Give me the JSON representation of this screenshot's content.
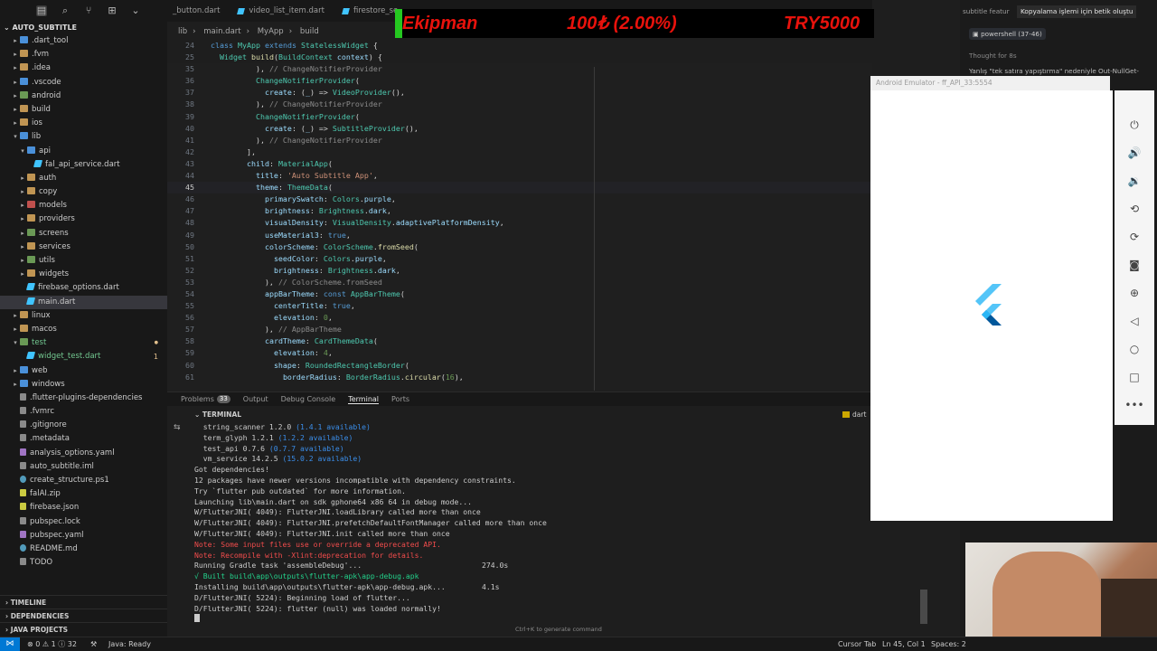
{
  "explorer": {
    "title": "AUTO_SUBTITLE",
    "items": [
      {
        "label": ".dart_tool",
        "type": "folder",
        "color": "folder-b",
        "depth": 1,
        "arrow": "▸"
      },
      {
        "label": ".fvm",
        "type": "folder",
        "color": "folder",
        "depth": 1,
        "arrow": "▸"
      },
      {
        "label": ".idea",
        "type": "folder",
        "color": "folder",
        "depth": 1,
        "arrow": "▸"
      },
      {
        "label": ".vscode",
        "type": "folder",
        "color": "folder-b",
        "depth": 1,
        "arrow": "▸"
      },
      {
        "label": "android",
        "type": "folder",
        "color": "folder-g",
        "depth": 1,
        "arrow": "▸"
      },
      {
        "label": "build",
        "type": "folder",
        "color": "folder",
        "depth": 1,
        "arrow": "▸"
      },
      {
        "label": "ios",
        "type": "folder",
        "color": "folder",
        "depth": 1,
        "arrow": "▸"
      },
      {
        "label": "lib",
        "type": "folder",
        "color": "folder-b",
        "depth": 1,
        "arrow": "▾"
      },
      {
        "label": "api",
        "type": "folder",
        "color": "folder-b",
        "depth": 2,
        "arrow": "▾"
      },
      {
        "label": "fal_api_service.dart",
        "type": "dart",
        "color": "dart",
        "depth": 3,
        "arrow": ""
      },
      {
        "label": "auth",
        "type": "folder",
        "color": "folder",
        "depth": 2,
        "arrow": "▸"
      },
      {
        "label": "copy",
        "type": "folder",
        "color": "folder",
        "depth": 2,
        "arrow": "▸"
      },
      {
        "label": "models",
        "type": "folder",
        "color": "folder-r",
        "depth": 2,
        "arrow": "▸"
      },
      {
        "label": "providers",
        "type": "folder",
        "color": "folder",
        "depth": 2,
        "arrow": "▸"
      },
      {
        "label": "screens",
        "type": "folder",
        "color": "folder-g",
        "depth": 2,
        "arrow": "▸"
      },
      {
        "label": "services",
        "type": "folder",
        "color": "folder",
        "depth": 2,
        "arrow": "▸"
      },
      {
        "label": "utils",
        "type": "folder",
        "color": "folder-g",
        "depth": 2,
        "arrow": "▸"
      },
      {
        "label": "widgets",
        "type": "folder",
        "color": "folder",
        "depth": 2,
        "arrow": "▸"
      },
      {
        "label": "firebase_options.dart",
        "type": "dart",
        "color": "dart",
        "depth": 2,
        "arrow": ""
      },
      {
        "label": "main.dart",
        "type": "dart",
        "color": "dart",
        "depth": 2,
        "arrow": "",
        "selected": true
      },
      {
        "label": "linux",
        "type": "folder",
        "color": "folder",
        "depth": 1,
        "arrow": "▸"
      },
      {
        "label": "macos",
        "type": "folder",
        "color": "folder",
        "depth": 1,
        "arrow": "▸"
      },
      {
        "label": "test",
        "type": "folder",
        "color": "folder-g",
        "depth": 1,
        "arrow": "▾",
        "modified": true
      },
      {
        "label": "widget_test.dart",
        "type": "dart",
        "color": "dart",
        "depth": 2,
        "arrow": "",
        "modified": true,
        "badge": "1"
      },
      {
        "label": "web",
        "type": "folder",
        "color": "folder-b",
        "depth": 1,
        "arrow": "▸"
      },
      {
        "label": "windows",
        "type": "folder",
        "color": "folder-b",
        "depth": 1,
        "arrow": "▸"
      },
      {
        "label": ".flutter-plugins-dependencies",
        "type": "file",
        "color": "file",
        "depth": 1,
        "arrow": ""
      },
      {
        "label": ".fvmrc",
        "type": "file",
        "color": "file",
        "depth": 1,
        "arrow": ""
      },
      {
        "label": ".gitignore",
        "type": "file",
        "color": "file",
        "depth": 1,
        "arrow": ""
      },
      {
        "label": ".metadata",
        "type": "file",
        "color": "file",
        "depth": 1,
        "arrow": ""
      },
      {
        "label": "analysis_options.yaml",
        "type": "yaml",
        "color": "yaml",
        "depth": 1,
        "arrow": ""
      },
      {
        "label": "auto_subtitle.iml",
        "type": "file",
        "color": "file",
        "depth": 1,
        "arrow": ""
      },
      {
        "label": "create_structure.ps1",
        "type": "file",
        "color": "info",
        "depth": 1,
        "arrow": ""
      },
      {
        "label": "falAI.zip",
        "type": "file",
        "color": "json",
        "depth": 1,
        "arrow": ""
      },
      {
        "label": "firebase.json",
        "type": "json",
        "color": "json",
        "depth": 1,
        "arrow": ""
      },
      {
        "label": "pubspec.lock",
        "type": "file",
        "color": "file",
        "depth": 1,
        "arrow": ""
      },
      {
        "label": "pubspec.yaml",
        "type": "yaml",
        "color": "yaml",
        "depth": 1,
        "arrow": ""
      },
      {
        "label": "README.md",
        "type": "info",
        "color": "info",
        "depth": 1,
        "arrow": ""
      },
      {
        "label": "TODO",
        "type": "file",
        "color": "file",
        "depth": 1,
        "arrow": ""
      }
    ],
    "sections": [
      "TIMELINE",
      "DEPENDENCIES",
      "JAVA PROJECTS"
    ]
  },
  "tabs": [
    {
      "label": "_button.dart"
    },
    {
      "label": "video_list_item.dart"
    },
    {
      "label": "firestore_se"
    }
  ],
  "breadcrumb": [
    "lib",
    "main.dart",
    "MyApp",
    "build"
  ],
  "code": {
    "sticky": [
      {
        "ln": "24",
        "html": "<span class='k'>class</span> <span class='t'>MyApp</span> <span class='k'>extends</span> <span class='t'>StatelessWidget</span> {"
      },
      {
        "ln": "25",
        "html": "  <span class='t'>Widget</span> <span class='f'>build</span>(<span class='t'>BuildContext</span> <span class='p'>context</span>) {"
      }
    ],
    "lines": [
      {
        "ln": "35",
        "html": "          ), <span class='cmt'>// ChangeNotifierProvider</span>"
      },
      {
        "ln": "36",
        "html": "          <span class='t'>ChangeNotifierProvider</span>("
      },
      {
        "ln": "37",
        "html": "            <span class='p'>create</span>: (<span class='p'>_</span>) => <span class='t'>VideoProvider</span>(),"
      },
      {
        "ln": "38",
        "html": "          ), <span class='cmt'>// ChangeNotifierProvider</span>"
      },
      {
        "ln": "39",
        "html": "          <span class='t'>ChangeNotifierProvider</span>("
      },
      {
        "ln": "40",
        "html": "            <span class='p'>create</span>: (<span class='p'>_</span>) => <span class='t'>SubtitleProvider</span>(),"
      },
      {
        "ln": "41",
        "html": "          ), <span class='cmt'>// ChangeNotifierProvider</span>"
      },
      {
        "ln": "42",
        "html": "        ],"
      },
      {
        "ln": "43",
        "html": "        <span class='p'>child</span>: <span class='t'>MaterialApp</span>("
      },
      {
        "ln": "44",
        "html": "          <span class='p'>title</span>: <span class='s'>'Auto Subtitle App'</span>,"
      },
      {
        "ln": "45",
        "html": "          <span class='p'>theme</span>: <span class='t'>ThemeData</span>(",
        "current": true
      },
      {
        "ln": "46",
        "html": "            <span class='p'>primarySwatch</span>: <span class='t'>Colors</span>.<span class='p'>purple</span>,"
      },
      {
        "ln": "47",
        "html": "            <span class='p'>brightness</span>: <span class='t'>Brightness</span>.<span class='p'>dark</span>,"
      },
      {
        "ln": "48",
        "html": "            <span class='p'>visualDensity</span>: <span class='t'>VisualDensity</span>.<span class='p'>adaptivePlatformDensity</span>,"
      },
      {
        "ln": "49",
        "html": "            <span class='p'>useMaterial3</span>: <span class='k'>true</span>,"
      },
      {
        "ln": "50",
        "html": "            <span class='p'>colorScheme</span>: <span class='t'>ColorScheme</span>.<span class='f'>fromSeed</span>("
      },
      {
        "ln": "51",
        "html": "              <span class='p'>seedColor</span>: <span class='t'>Colors</span>.<span class='p'>purple</span>,"
      },
      {
        "ln": "52",
        "html": "              <span class='p'>brightness</span>: <span class='t'>Brightness</span>.<span class='p'>dark</span>,"
      },
      {
        "ln": "53",
        "html": "            ), <span class='cmt'>// ColorScheme.fromSeed</span>"
      },
      {
        "ln": "54",
        "html": "            <span class='p'>appBarTheme</span>: <span class='k'>const</span> <span class='t'>AppBarTheme</span>("
      },
      {
        "ln": "55",
        "html": "              <span class='p'>centerTitle</span>: <span class='k'>true</span>,"
      },
      {
        "ln": "56",
        "html": "              <span class='p'>elevation</span>: <span class='c'>0</span>,"
      },
      {
        "ln": "57",
        "html": "            ), <span class='cmt'>// AppBarTheme</span>"
      },
      {
        "ln": "58",
        "html": "            <span class='p'>cardTheme</span>: <span class='t'>CardThemeData</span>("
      },
      {
        "ln": "59",
        "html": "              <span class='p'>elevation</span>: <span class='c'>4</span>,"
      },
      {
        "ln": "60",
        "html": "              <span class='p'>shape</span>: <span class='t'>RoundedRectangleBorder</span>("
      },
      {
        "ln": "61",
        "html": "                <span class='p'>borderRadius</span>: <span class='t'>BorderRadius</span>.<span class='f'>circular</span>(<span class='c'>16</span>),"
      }
    ]
  },
  "panel": {
    "tabs": [
      {
        "label": "Problems",
        "count": "33"
      },
      {
        "label": "Output"
      },
      {
        "label": "Debug Console"
      },
      {
        "label": "Terminal",
        "active": true
      },
      {
        "label": "Ports"
      }
    ],
    "terminal_label": "TERMINAL",
    "terminal_indicator": "dart",
    "generate_hint": "Ctrl+K to generate command"
  },
  "terminal_lines": [
    {
      "text": "  string_scanner 1.2.0 ",
      "avail": "(1.4.1 available)"
    },
    {
      "text": "  term_glyph 1.2.1 ",
      "avail": "(1.2.2 available)"
    },
    {
      "text": "  test_api 0.7.6 ",
      "avail": "(0.7.7 available)"
    },
    {
      "text": "  vm_service 14.2.5 ",
      "avail": "(15.0.2 available)"
    },
    {
      "text": "Got dependencies!"
    },
    {
      "text": "12 packages have newer versions incompatible with dependency constraints."
    },
    {
      "text": "Try `flutter pub outdated` for more information."
    },
    {
      "text": "Launching lib\\main.dart on sdk gphone64 x86 64 in debug mode..."
    },
    {
      "text": "W/FlutterJNI( 4049): FlutterJNI.loadLibrary called more than once"
    },
    {
      "text": "W/FlutterJNI( 4049): FlutterJNI.prefetchDefaultFontManager called more than once"
    },
    {
      "text": "W/FlutterJNI( 4049): FlutterJNI.init called more than once"
    },
    {
      "text": "Note: Some input files use or override a deprecated API.",
      "cls": "red"
    },
    {
      "text": "Note: Recompile with -Xlint:deprecation for details.",
      "cls": "red"
    },
    {
      "text": "Running Gradle task 'assembleDebug'...",
      "time": "274.0s"
    },
    {
      "text": "√ Built build\\app\\outputs\\flutter-apk\\app-debug.apk",
      "cls": "grn"
    },
    {
      "text": "Installing build\\app\\outputs\\flutter-apk\\app-debug.apk...",
      "time": "4.1s"
    },
    {
      "text": "D/FlutterJNI( 5224): Beginning load of flutter..."
    },
    {
      "text": "D/FlutterJNI( 5224): flutter (null) was loaded normally!"
    }
  ],
  "status": {
    "errors": "0",
    "warnings": "1",
    "info": "32",
    "java": "Java: Ready",
    "cursor_tab": "Cursor Tab",
    "position": "Ln 45, Col 1",
    "spaces": "Spaces: 2"
  },
  "chat": {
    "tabs": [
      "subtitle featur",
      "Kopyalama işlemi için betik oluştu"
    ],
    "chip": "powershell (37-46)",
    "thought": "Thought for 8s",
    "text": "Yanlış \"tek satıra yapıştırma\" nedeniyle Out-NullGet-"
  },
  "emulator": {
    "title": "Android Emulator - ff_API_33:5554"
  },
  "ticker": {
    "name": "Ekipman",
    "change": "100₺ (2.00%)",
    "price": "TRY5000"
  }
}
